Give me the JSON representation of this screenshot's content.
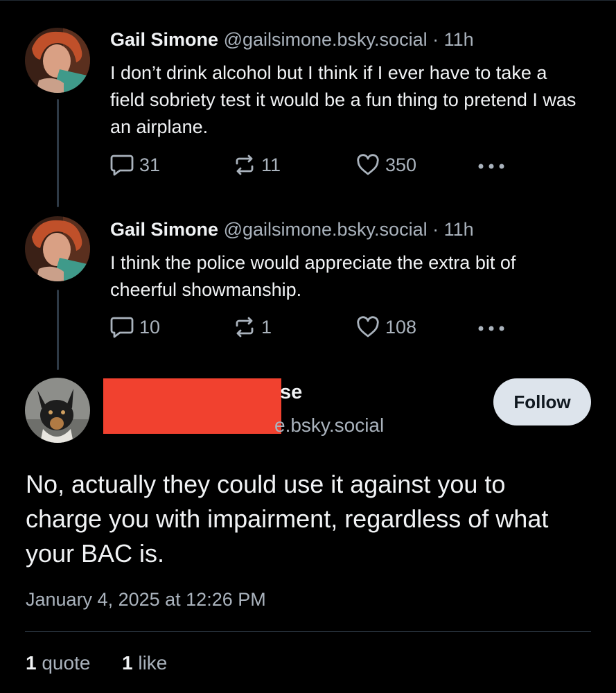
{
  "thread": [
    {
      "author_name": "Gail Simone",
      "handle": "@gailsimone.bsky.social",
      "separator": "·",
      "time": "11h",
      "text": "I don’t drink alcohol but I think if I ever have to take a field sobriety test it would be a fun thing to pretend I was an airplane.",
      "replies": "31",
      "reposts": "11",
      "likes": "350"
    },
    {
      "author_name": "Gail Simone",
      "handle": "@gailsimone.bsky.social",
      "separator": "·",
      "time": "11h",
      "text": "I think the police would appreciate the extra bit of cheerful showmanship.",
      "replies": "10",
      "reposts": "1",
      "likes": "108"
    }
  ],
  "main_post": {
    "visible_name_fragment": "se",
    "visible_handle_fragment": "e.bsky.social",
    "follow_label": "Follow",
    "text": "No, actually they could use it against you to charge you with impairment, regardless of what your BAC is.",
    "date": "January 4, 2025 at 12:26 PM",
    "quote_count": "1",
    "quote_label": "quote",
    "like_count": "1",
    "like_label": "like"
  },
  "colors": {
    "background": "#000000",
    "text": "#f1f3f5",
    "muted": "#aab3bd",
    "thread_line": "#2e3a46",
    "redaction": "#f1412f",
    "follow_button": "#dde4ec"
  },
  "icons": {
    "reply": "speech-bubble-icon",
    "repost": "repost-arrows-icon",
    "like": "heart-icon",
    "more": "ellipsis-icon"
  }
}
